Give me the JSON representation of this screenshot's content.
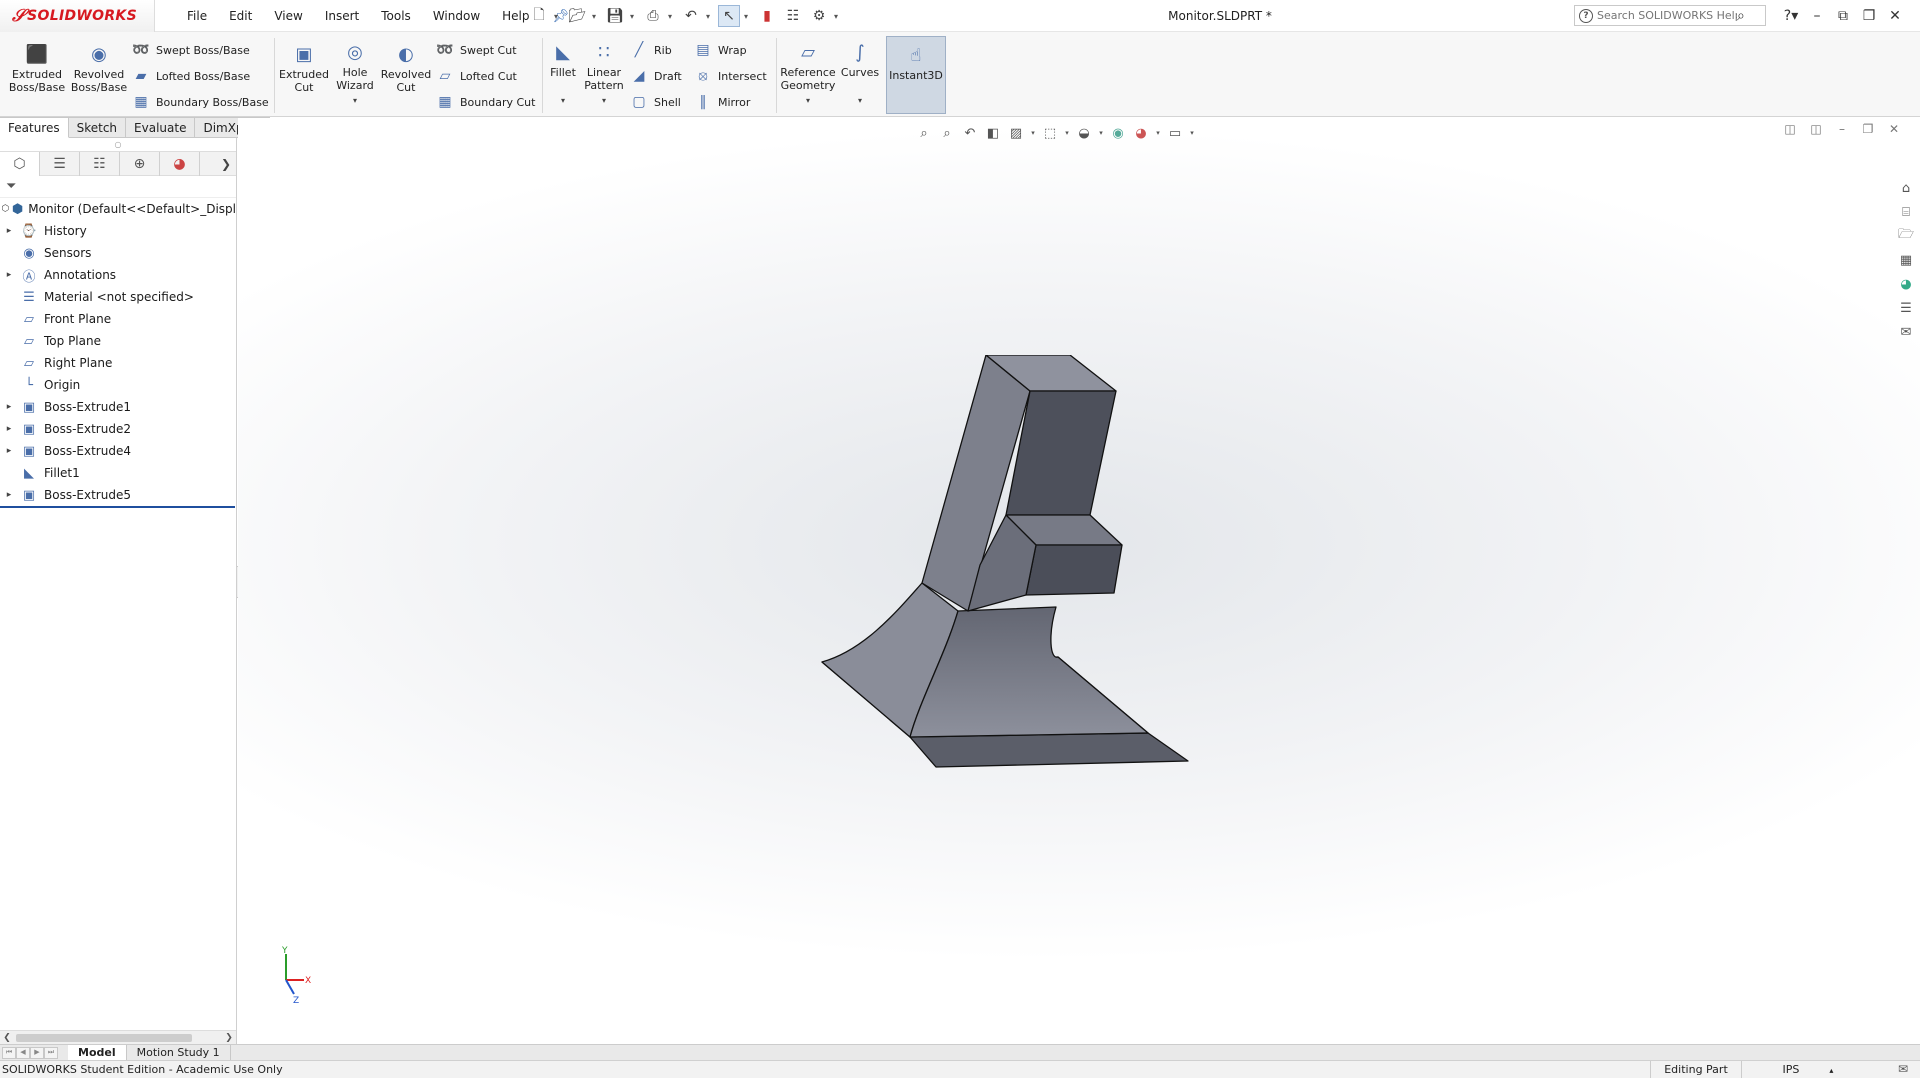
{
  "app": {
    "logo": "SOLIDWORKS",
    "document_title": "Monitor.SLDPRT *"
  },
  "menu": [
    "File",
    "Edit",
    "View",
    "Insert",
    "Tools",
    "Window",
    "Help"
  ],
  "search": {
    "placeholder": "Search SOLIDWORKS Help"
  },
  "command_manager": {
    "extruded_boss": "Extruded\nBoss/Base",
    "revolved_boss": "Revolved\nBoss/Base",
    "swept_boss": "Swept Boss/Base",
    "lofted_boss": "Lofted Boss/Base",
    "boundary_boss": "Boundary Boss/Base",
    "extruded_cut": "Extruded\nCut",
    "hole_wizard": "Hole\nWizard",
    "revolved_cut": "Revolved\nCut",
    "swept_cut": "Swept Cut",
    "lofted_cut": "Lofted Cut",
    "boundary_cut": "Boundary Cut",
    "fillet": "Fillet",
    "linear_pattern": "Linear\nPattern",
    "rib": "Rib",
    "draft": "Draft",
    "shell": "Shell",
    "wrap": "Wrap",
    "intersect": "Intersect",
    "mirror": "Mirror",
    "reference_geometry": "Reference\nGeometry",
    "curves": "Curves",
    "instant3d": "Instant3D"
  },
  "tabs": [
    "Features",
    "Sketch",
    "Evaluate",
    "DimXpert"
  ],
  "feature_tree": {
    "root": "Monitor  (Default<<Default>_Displ",
    "items": [
      "History",
      "Sensors",
      "Annotations",
      "Material <not specified>",
      "Front Plane",
      "Top Plane",
      "Right Plane",
      "Origin",
      "Boss-Extrude1",
      "Boss-Extrude2",
      "Boss-Extrude4",
      "Fillet1",
      "Boss-Extrude5"
    ]
  },
  "triad": {
    "y": "Y",
    "x": "X",
    "z": "Z"
  },
  "bottom_tabs": [
    "Model",
    "Motion Study 1"
  ],
  "status": {
    "edition": "SOLIDWORKS Student Edition - Academic Use Only",
    "mode": "Editing Part",
    "units": "IPS"
  },
  "colors": {
    "brand": "#d71920",
    "model_face": "#6b6e7a"
  }
}
